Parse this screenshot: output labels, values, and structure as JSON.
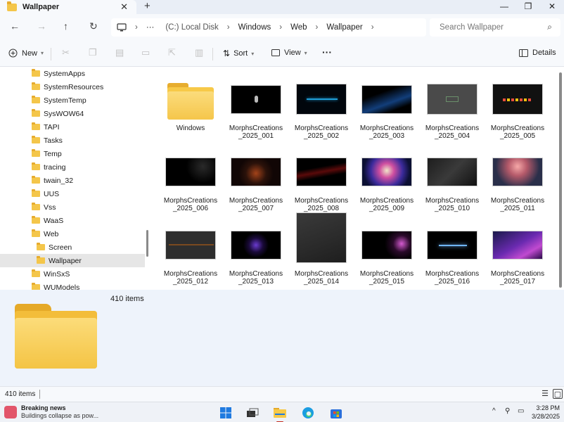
{
  "window": {
    "tab_title": "Wallpaper",
    "close_tab": "✕",
    "new_tab": "+",
    "minimize": "—",
    "maximize": "❐",
    "close": "✕"
  },
  "nav": {
    "back": "←",
    "forward": "→",
    "up": "↑",
    "refresh": "↻"
  },
  "address": {
    "more": "···",
    "crumbs": [
      "(C:) Local Disk",
      "Windows",
      "Web",
      "Wallpaper"
    ],
    "separator": "›"
  },
  "search": {
    "placeholder": "Search Wallpaper",
    "icon": "⌕"
  },
  "toolbar": {
    "new_label": "New",
    "sort_label": "Sort",
    "view_label": "View",
    "more": "···",
    "details_label": "Details"
  },
  "sidebar": {
    "items": [
      {
        "label": "SystemApps"
      },
      {
        "label": "SystemResources"
      },
      {
        "label": "SystemTemp"
      },
      {
        "label": "SysWOW64"
      },
      {
        "label": "TAPI"
      },
      {
        "label": "Tasks"
      },
      {
        "label": "Temp"
      },
      {
        "label": "tracing"
      },
      {
        "label": "twain_32"
      },
      {
        "label": "UUS"
      },
      {
        "label": "Vss"
      },
      {
        "label": "WaaS"
      },
      {
        "label": "Web"
      },
      {
        "label": "Screen"
      },
      {
        "label": "Wallpaper"
      },
      {
        "label": "WinSxS"
      },
      {
        "label": "WUModels"
      }
    ]
  },
  "files": [
    {
      "line1": "Windows",
      "line2": ""
    },
    {
      "line1": "MorphsCreations",
      "line2": "_2025_001"
    },
    {
      "line1": "MorphsCreations",
      "line2": "_2025_002"
    },
    {
      "line1": "MorphsCreations",
      "line2": "_2025_003"
    },
    {
      "line1": "MorphsCreations",
      "line2": "_2025_004"
    },
    {
      "line1": "MorphsCreations",
      "line2": "_2025_005"
    },
    {
      "line1": "MorphsCreations",
      "line2": "_2025_006"
    },
    {
      "line1": "MorphsCreations",
      "line2": "_2025_007"
    },
    {
      "line1": "MorphsCreations",
      "line2": "_2025_008"
    },
    {
      "line1": "MorphsCreations",
      "line2": "_2025_009"
    },
    {
      "line1": "MorphsCreations",
      "line2": "_2025_010"
    },
    {
      "line1": "MorphsCreations",
      "line2": "_2025_011"
    },
    {
      "line1": "MorphsCreations",
      "line2": "_2025_012"
    },
    {
      "line1": "MorphsCreations",
      "line2": "_2025_013"
    },
    {
      "line1": "MorphsCreations",
      "line2": "_2025_014"
    },
    {
      "line1": "MorphsCreations",
      "line2": "_2025_015"
    },
    {
      "line1": "MorphsCreations",
      "line2": "_2025_016"
    },
    {
      "line1": "MorphsCreations",
      "line2": "_2025_017"
    }
  ],
  "details_pane": {
    "count": "410 items"
  },
  "status": {
    "count": "410 items"
  },
  "taskbar": {
    "news_title": "Breaking news",
    "news_sub": "Buildings collapse as pow...",
    "time": "3:28 PM",
    "date": "3/28/2025",
    "tray_chevron": "^"
  },
  "colors": {
    "folder": "#f4c64a",
    "accent": "#c42b1c",
    "selection": "#e6e6e6"
  }
}
